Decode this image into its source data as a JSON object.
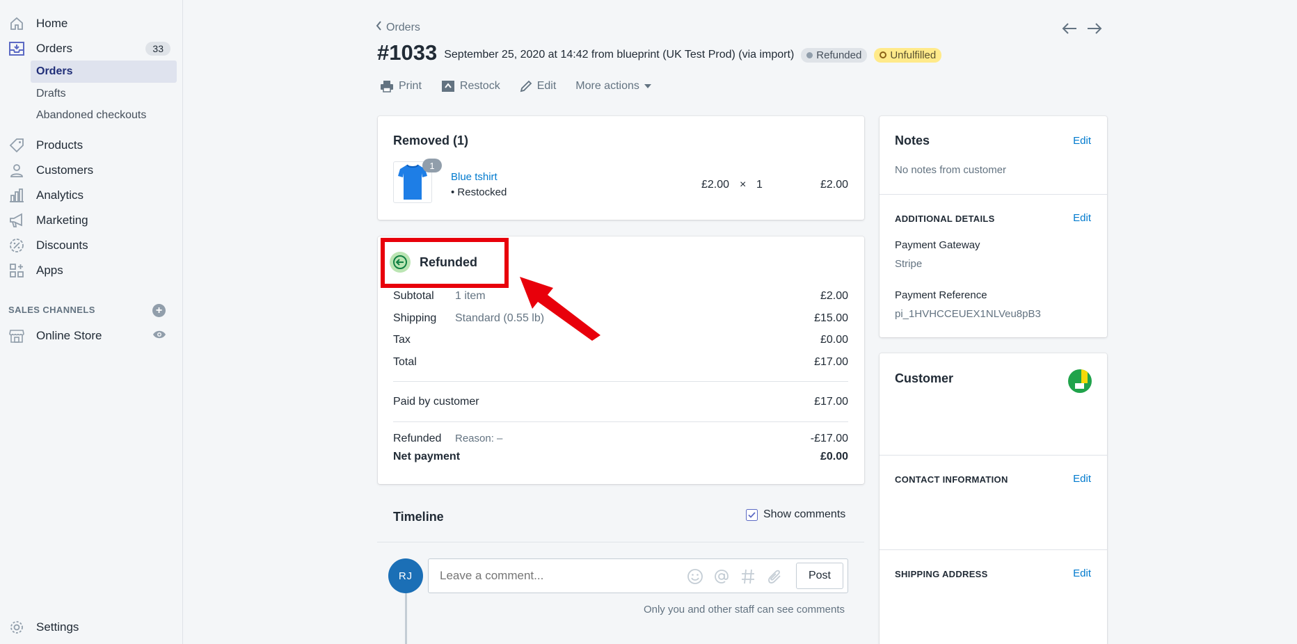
{
  "sidebar": {
    "items": [
      {
        "label": "Home",
        "icon": "home-icon"
      },
      {
        "label": "Orders",
        "icon": "orders-icon",
        "badge": "33"
      },
      {
        "label": "Products",
        "icon": "tag-icon"
      },
      {
        "label": "Customers",
        "icon": "person-icon"
      },
      {
        "label": "Analytics",
        "icon": "bar-chart-icon"
      },
      {
        "label": "Marketing",
        "icon": "megaphone-icon"
      },
      {
        "label": "Discounts",
        "icon": "discount-icon"
      },
      {
        "label": "Apps",
        "icon": "apps-icon"
      }
    ],
    "orders_sub": [
      "Orders",
      "Drafts",
      "Abandoned checkouts"
    ],
    "sales_channels_label": "SALES CHANNELS",
    "online_store": "Online Store",
    "settings": "Settings"
  },
  "header": {
    "breadcrumb": "Orders",
    "order_number": "#1033",
    "meta": "September 25, 2020 at 14:42 from blueprint (UK Test Prod) (via import)",
    "status_payment": "Refunded",
    "status_fulfillment": "Unfulfilled",
    "actions": {
      "print": "Print",
      "restock": "Restock",
      "edit": "Edit",
      "more": "More actions"
    }
  },
  "removed": {
    "title": "Removed (1)",
    "qty_badge": "1",
    "product_name": "Blue tshirt",
    "product_note": "• Restocked",
    "unit_price": "£2.00",
    "times": "×",
    "quantity": "1",
    "line_total": "£2.00"
  },
  "refunded": {
    "title": "Refunded",
    "rows": {
      "subtotal": {
        "k": "Subtotal",
        "d": "1 item",
        "v": "£2.00"
      },
      "shipping": {
        "k": "Shipping",
        "d": "Standard (0.55 lb)",
        "v": "£15.00"
      },
      "tax": {
        "k": "Tax",
        "d": "",
        "v": "£0.00"
      },
      "total": {
        "k": "Total",
        "d": "",
        "v": "£17.00"
      },
      "paid": {
        "k": "Paid by customer",
        "v": "£17.00"
      },
      "refund": {
        "k": "Refunded",
        "d": "Reason: –",
        "v": "-£17.00"
      },
      "net": {
        "k": "Net payment",
        "v": "£0.00"
      }
    }
  },
  "timeline": {
    "title": "Timeline",
    "show_comments": "Show comments",
    "avatar_initials": "RJ",
    "comment_placeholder": "Leave a comment...",
    "post": "Post",
    "staff_note": "Only you and other staff can see comments"
  },
  "notes": {
    "title": "Notes",
    "edit": "Edit",
    "body": "No notes from customer",
    "additional_title": "ADDITIONAL DETAILS",
    "additional_edit": "Edit",
    "gateway_label": "Payment Gateway",
    "gateway_value": "Stripe",
    "reference_label": "Payment Reference",
    "reference_value": "pi_1HVHCCEUEX1NLVeu8pB3"
  },
  "customer": {
    "title": "Customer",
    "contact_title": "CONTACT INFORMATION",
    "contact_edit": "Edit",
    "shipping_title": "SHIPPING ADDRESS",
    "shipping_edit": "Edit"
  },
  "colors": {
    "accent": "#007ace",
    "highlight": "#e8000b",
    "nav_active": "#202e78"
  }
}
